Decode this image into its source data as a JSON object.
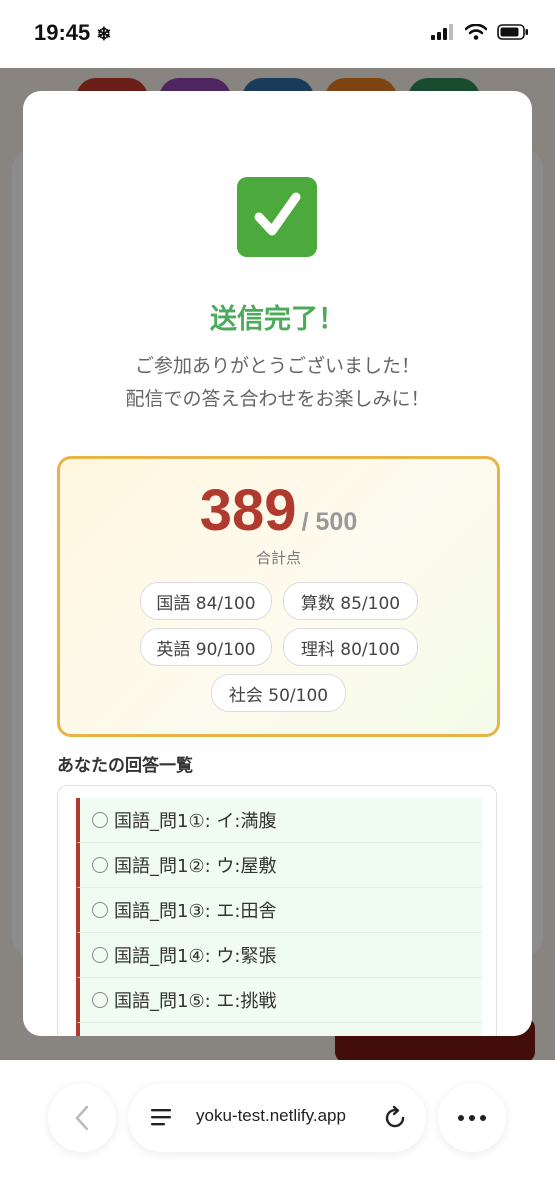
{
  "status_bar": {
    "time": "19:45",
    "time_icon": "snowflake-icon"
  },
  "background": {
    "pill_colors": [
      "#c0392b",
      "#8e44ad",
      "#2e6da4",
      "#e67e22",
      "#2e8b57"
    ],
    "dark_button_color": "#7a1a12"
  },
  "modal": {
    "icon": "checkmark-icon",
    "title": "送信完了！",
    "message_line1": "ご参加ありがとうございました！",
    "message_line2": "配信での答え合わせをお楽しみに！",
    "score": {
      "total": "389",
      "max": "/ 500",
      "label": "合計点",
      "subjects": [
        "国語 84/100",
        "算数 85/100",
        "英語 90/100",
        "理科 80/100",
        "社会 50/100"
      ]
    },
    "answers_heading": "あなたの回答一覧",
    "answers": [
      "国語_問1①: イ:満腹",
      "国語_問1②: ウ:屋敷",
      "国語_問1③: エ:田舎",
      "国語_問1④: ウ:緊張",
      "国語_問1⑤: エ:挑戦"
    ]
  },
  "browser": {
    "url": "yoku-test.netlify.app"
  },
  "colors": {
    "accent_green": "#4caa5a",
    "score_red": "#b03a2e",
    "box_border": "#e8b44a"
  }
}
